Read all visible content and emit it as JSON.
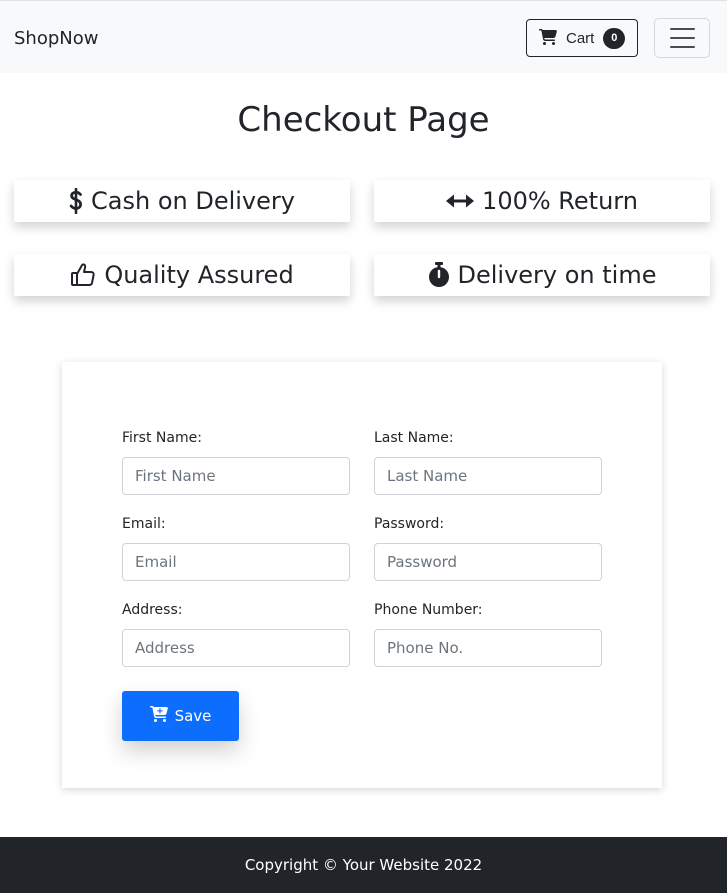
{
  "navbar": {
    "brand": "ShopNow",
    "cart_label": "Cart",
    "cart_count": "0"
  },
  "page_title": "Checkout Page",
  "features": [
    {
      "label": "Cash on Delivery",
      "icon": "dollar-icon"
    },
    {
      "label": "100% Return",
      "icon": "arrows-horizontal-icon"
    },
    {
      "label": "Quality Assured",
      "icon": "thumbs-up-icon"
    },
    {
      "label": "Delivery on time",
      "icon": "stopwatch-icon"
    }
  ],
  "form": {
    "first_name": {
      "label": "First Name:",
      "placeholder": "First Name"
    },
    "last_name": {
      "label": "Last Name:",
      "placeholder": "Last Name"
    },
    "email": {
      "label": "Email:",
      "placeholder": "Email"
    },
    "password": {
      "label": "Password:",
      "placeholder": "Password"
    },
    "address": {
      "label": "Address:",
      "placeholder": "Address"
    },
    "phone": {
      "label": "Phone Number:",
      "placeholder": "Phone No."
    },
    "save_label": "Save"
  },
  "footer": {
    "text": "Copyright © Your Website 2022"
  },
  "colors": {
    "primary": "#0d6efd",
    "dark": "#212529",
    "navbar_bg": "#f8f9fa"
  }
}
